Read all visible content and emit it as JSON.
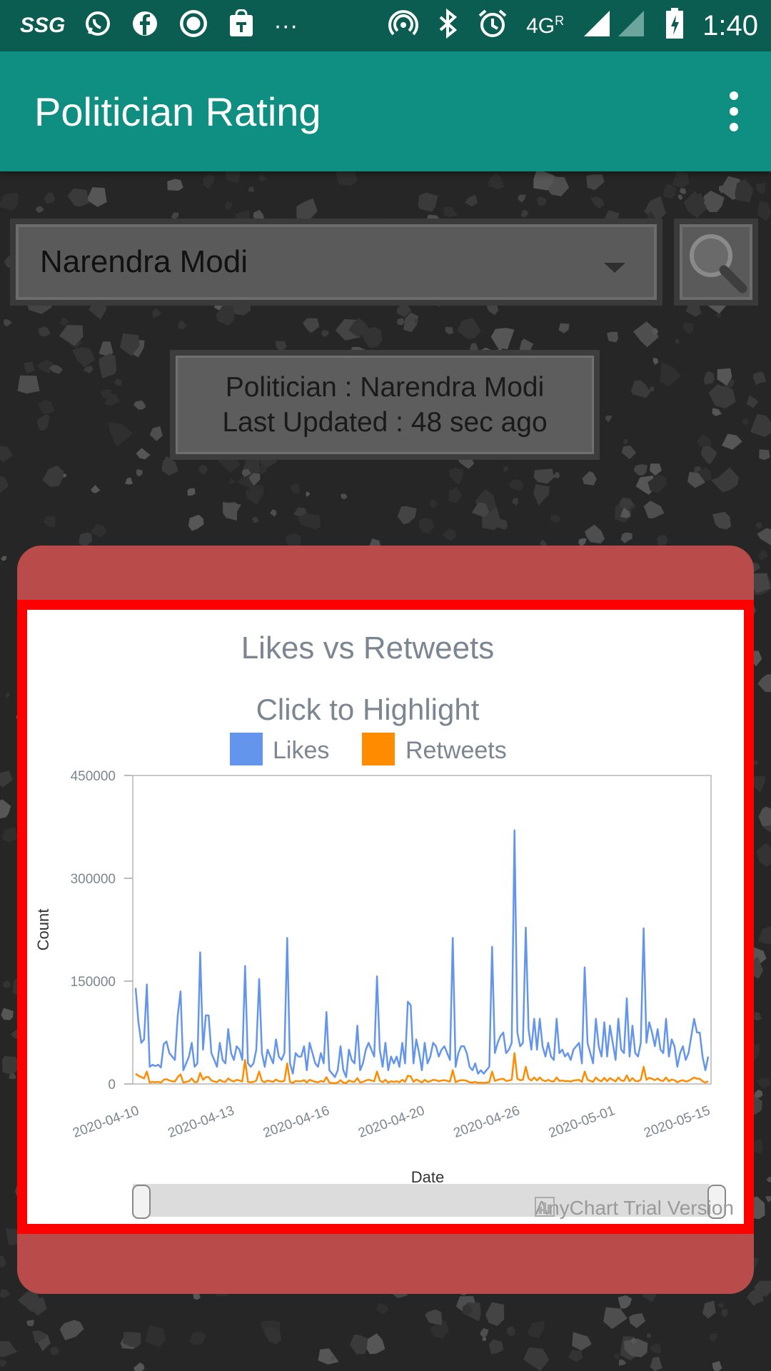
{
  "status_bar": {
    "left_icons": [
      "ssg-icon",
      "whatsapp-icon",
      "facebook-icon",
      "ring-icon",
      "shopping-bag-icon",
      "more-dots"
    ],
    "carrier_badge": "SSG",
    "network": "4G",
    "roaming": "R",
    "time": "1:40"
  },
  "app_bar": {
    "title": "Politician Rating"
  },
  "selector": {
    "value": "Narendra Modi"
  },
  "info": {
    "politician_line": "Politician : Narendra Modi",
    "updated_line": "Last Updated : 48 sec ago"
  },
  "chart_data": {
    "type": "line",
    "title": "Likes vs Retweets",
    "subtitle": "Click to Highlight",
    "xlabel": "Date",
    "ylabel": "Count",
    "ylim": [
      0,
      450000
    ],
    "yticks": [
      0,
      150000,
      300000,
      450000
    ],
    "xticks": [
      "2020-04-10",
      "2020-04-13",
      "2020-04-16",
      "2020-04-20",
      "2020-04-26",
      "2020-05-01",
      "2020-05-15"
    ],
    "legend": "top-center",
    "colors": {
      "Likes": "#6495ed",
      "Retweets": "#ff8c00"
    },
    "series": [
      {
        "name": "Likes",
        "values": [
          140000,
          90000,
          60000,
          65000,
          145000,
          25000,
          28000,
          26000,
          28000,
          24000,
          58000,
          62000,
          45000,
          40000,
          35000,
          100000,
          135000,
          20000,
          30000,
          40000,
          60000,
          25000,
          30000,
          192000,
          50000,
          100000,
          100000,
          45000,
          35000,
          25000,
          60000,
          35000,
          30000,
          80000,
          45000,
          35000,
          55000,
          50000,
          35000,
          172000,
          30000,
          25000,
          30000,
          50000,
          153000,
          45000,
          25000,
          50000,
          40000,
          30000,
          65000,
          40000,
          35000,
          45000,
          213000,
          30000,
          15000,
          45000,
          40000,
          40000,
          55000,
          20000,
          60000,
          45000,
          30000,
          25000,
          45000,
          30000,
          105000,
          20000,
          15000,
          10000,
          20000,
          55000,
          20000,
          10000,
          50000,
          35000,
          30000,
          85000,
          20000,
          30000,
          50000,
          60000,
          50000,
          40000,
          157000,
          50000,
          25000,
          60000,
          20000,
          40000,
          30000,
          40000,
          25000,
          60000,
          30000,
          120000,
          115000,
          30000,
          65000,
          45000,
          20000,
          60000,
          30000,
          40000,
          60000,
          55000,
          40000,
          50000,
          55000,
          45000,
          35000,
          213000,
          25000,
          45000,
          55000,
          55000,
          45000,
          25000,
          20000,
          30000,
          15000,
          20000,
          15000,
          20000,
          25000,
          200000,
          45000,
          60000,
          70000,
          75000,
          45000,
          50000,
          60000,
          370000,
          75000,
          55000,
          60000,
          228000,
          80000,
          50000,
          95000,
          50000,
          95000,
          55000,
          40000,
          60000,
          40000,
          35000,
          95000,
          45000,
          50000,
          40000,
          45000,
          35000,
          50000,
          55000,
          60000,
          30000,
          170000,
          60000,
          45000,
          30000,
          95000,
          55000,
          40000,
          90000,
          40000,
          85000,
          60000,
          35000,
          95000,
          50000,
          45000,
          125000,
          40000,
          85000,
          45000,
          40000,
          60000,
          227000,
          60000,
          90000,
          75000,
          55000,
          80000,
          50000,
          45000,
          95000,
          40000,
          65000,
          55000,
          25000,
          45000,
          55000,
          35000,
          45000,
          70000,
          95000,
          75000,
          75000,
          40000,
          20000,
          40000
        ],
        "values_note": "approximated from chart"
      },
      {
        "name": "Retweets",
        "values": [
          15000,
          12000,
          10000,
          8000,
          18000,
          2000,
          3000,
          2500,
          3000,
          2000,
          6000,
          7000,
          5000,
          4000,
          3500,
          10000,
          14000,
          2000,
          3000,
          4000,
          8000,
          2500,
          3000,
          16000,
          6000,
          10000,
          10000,
          5000,
          3500,
          2500,
          6000,
          3500,
          3000,
          8000,
          5000,
          3500,
          6000,
          5000,
          3500,
          35000,
          3000,
          2500,
          3000,
          5000,
          18000,
          4500,
          2500,
          5000,
          4000,
          3000,
          6500,
          4000,
          3500,
          4500,
          30000,
          3000,
          1500,
          4500,
          4000,
          4000,
          5500,
          2000,
          6000,
          4500,
          3000,
          2500,
          4500,
          3000,
          10000,
          2000,
          1500,
          1000,
          2000,
          5500,
          2000,
          1000,
          5000,
          3500,
          3000,
          8500,
          2000,
          3000,
          5000,
          6000,
          5000,
          4000,
          18000,
          5000,
          2500,
          6000,
          2000,
          4000,
          3000,
          4000,
          2500,
          6000,
          3000,
          12000,
          11000,
          3000,
          6500,
          4500,
          2000,
          6000,
          3000,
          4000,
          6000,
          5500,
          4000,
          5000,
          5500,
          4500,
          3500,
          20000,
          2500,
          4500,
          5500,
          5500,
          4500,
          2500,
          2000,
          3000,
          1500,
          2000,
          1500,
          2000,
          2500,
          18000,
          4500,
          6000,
          7000,
          7500,
          4500,
          5000,
          6000,
          45000,
          7500,
          5500,
          6000,
          25000,
          8000,
          5000,
          9500,
          5000,
          9500,
          5500,
          4000,
          6000,
          4000,
          3500,
          9500,
          4500,
          5000,
          4000,
          4500,
          3500,
          5000,
          5500,
          6000,
          3000,
          18000,
          6000,
          4500,
          3000,
          9500,
          5500,
          4000,
          9000,
          4000,
          8500,
          6000,
          3500,
          9500,
          5000,
          4500,
          12500,
          4000,
          8500,
          4500,
          4000,
          6000,
          25000,
          6000,
          9000,
          7500,
          5500,
          8000,
          5000,
          4500,
          9500,
          4000,
          6500,
          5500,
          2500,
          4500,
          5500,
          3500,
          4500,
          7000,
          9500,
          7500,
          7500,
          4000,
          2000,
          4000
        ]
      }
    ]
  },
  "range_slider": {
    "start_fraction": 0,
    "end_fraction": 1
  },
  "watermark": "AnyChart Trial Version"
}
